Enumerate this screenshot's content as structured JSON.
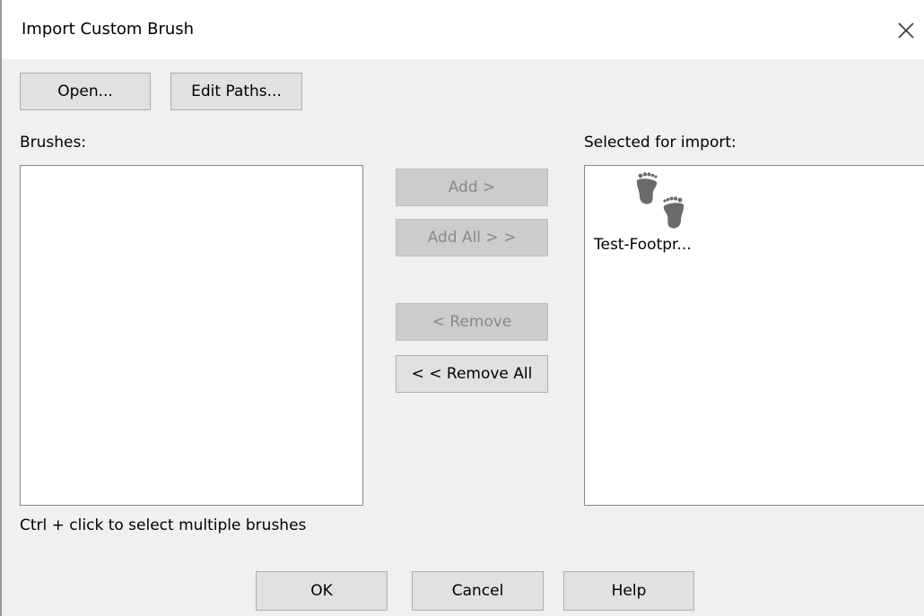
{
  "window": {
    "title": "Import Custom Brush",
    "close_icon": "close-icon"
  },
  "toolbar": {
    "open_label": "Open...",
    "edit_paths_label": "Edit Paths..."
  },
  "brushes": {
    "label": "Brushes:",
    "items": [],
    "hint": "Ctrl + click to select multiple brushes"
  },
  "transfer": {
    "add_label": "Add >",
    "add_all_label": "Add All > >",
    "remove_label": "< Remove",
    "remove_all_label": "< < Remove All"
  },
  "selected": {
    "label": "Selected for import:",
    "items": [
      {
        "name": "Test-Footpr...",
        "icon": "footprints-icon"
      }
    ]
  },
  "footer": {
    "ok_label": "OK",
    "cancel_label": "Cancel",
    "help_label": "Help"
  },
  "colors": {
    "dialog_bg": "#f0f0f0",
    "button_bg": "#e1e1e1",
    "disabled_button_bg": "#cccccc",
    "disabled_text": "#8a8a8a",
    "footprint": "#6b6b6b"
  }
}
